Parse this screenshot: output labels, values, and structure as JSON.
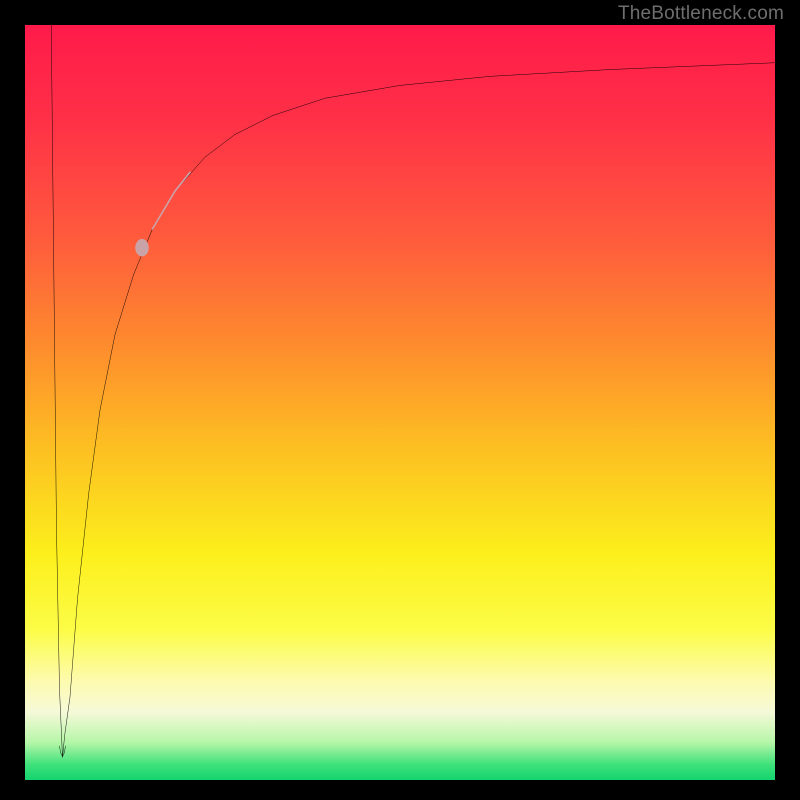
{
  "attribution": "TheBottleneck.com",
  "colors": {
    "frame": "#000000",
    "curve": "#000000",
    "highlight": "#caa3a8",
    "gradient_stops": [
      "#ff1a4a",
      "#ff5a3d",
      "#fdbf22",
      "#fcef1c",
      "#fdfbb0",
      "#14d46e"
    ]
  },
  "chart_data": {
    "type": "line",
    "title": "",
    "xlabel": "",
    "ylabel": "",
    "xlim": [
      0,
      100
    ],
    "ylim": [
      0,
      100
    ],
    "grid": false,
    "legend": false,
    "series": [
      {
        "name": "curve",
        "x": [
          3.5,
          4.2,
          5.0,
          6.0,
          7.0,
          8.5,
          10.0,
          12.0,
          14.5,
          17.0,
          20.0,
          24.0,
          28.0,
          33.0,
          40.0,
          50.0,
          62.0,
          78.0,
          100.0
        ],
        "y": [
          100.0,
          33.0,
          3.0,
          11.0,
          24.0,
          38.0,
          49.0,
          59.0,
          67.0,
          73.0,
          78.0,
          82.5,
          85.5,
          88.0,
          90.3,
          92.0,
          93.2,
          94.1,
          95.0
        ]
      },
      {
        "name": "highlight-segment",
        "x": [
          17.0,
          20.0,
          22.0
        ],
        "y": [
          73.0,
          78.0,
          80.5
        ]
      },
      {
        "name": "highlight-dot",
        "x": [
          15.6
        ],
        "y": [
          70.5
        ]
      }
    ]
  }
}
